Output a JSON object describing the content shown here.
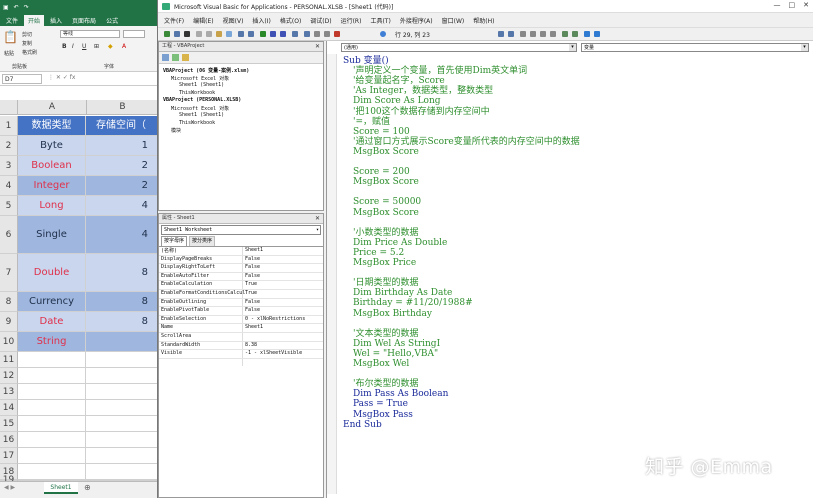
{
  "excel": {
    "ribbon_tabs": [
      "文件",
      "开始",
      "插入",
      "页面布局",
      "公式"
    ],
    "ribbon": {
      "paste": "粘贴",
      "cut": "剪切",
      "copy": "复制",
      "format_painter": "格式刷",
      "clipboard": "剪贴板",
      "font_name": "等线",
      "font_group": "字体"
    },
    "name_box": "D7",
    "columns": [
      "A",
      "B"
    ],
    "header": {
      "col_a": "数据类型",
      "col_b": "存储空间（"
    },
    "rows": [
      {
        "row": "1",
        "a": "数据类型",
        "b": "存储空间（"
      },
      {
        "row": "2",
        "a": "Byte",
        "b": "1"
      },
      {
        "row": "3",
        "a": "Boolean",
        "b": "2"
      },
      {
        "row": "4",
        "a": "Integer",
        "b": "2"
      },
      {
        "row": "5",
        "a": "Long",
        "b": "4"
      },
      {
        "row": "6",
        "a": "Single",
        "b": "4"
      },
      {
        "row": "7",
        "a": "Double",
        "b": "8"
      },
      {
        "row": "8",
        "a": "Currency",
        "b": "8"
      },
      {
        "row": "9",
        "a": "Date",
        "b": "8"
      },
      {
        "row": "10",
        "a": "String",
        "b": ""
      },
      {
        "row": "11",
        "a": "",
        "b": ""
      },
      {
        "row": "12",
        "a": "",
        "b": ""
      },
      {
        "row": "13",
        "a": "",
        "b": ""
      },
      {
        "row": "14",
        "a": "",
        "b": ""
      },
      {
        "row": "15",
        "a": "",
        "b": ""
      },
      {
        "row": "16",
        "a": "",
        "b": ""
      },
      {
        "row": "17",
        "a": "",
        "b": ""
      },
      {
        "row": "18",
        "a": "",
        "b": ""
      },
      {
        "row": "19",
        "a": "",
        "b": ""
      }
    ],
    "sheet_tab": "Sheet1",
    "colors": {
      "header": "#4472c4",
      "band_dark": "#9fb7df",
      "band_light": "#c9d6ee",
      "red_text": "#e0304a"
    }
  },
  "vba": {
    "title": "Microsoft Visual Basic for Applications - PERSONAL.XLSB - [Sheet1 (代码)]",
    "menu": [
      "文件(F)",
      "编辑(E)",
      "视图(V)",
      "插入(I)",
      "格式(O)",
      "调试(D)",
      "运行(R)",
      "工具(T)",
      "外接程序(A)",
      "窗口(W)",
      "帮助(H)"
    ],
    "cursor_pos": "行 29, 列 23",
    "project_pane": {
      "title": "工程 - VBAProject",
      "items": [
        "VBAProject (06  变量-案例.xlsm)",
        "Microsoft Excel 对象",
        "Sheet1 (Sheet1)",
        "ThisWorkbook",
        "VBAProject (PERSONAL.XLSB)",
        "Microsoft Excel 对象",
        "Sheet1 (Sheet1)",
        "ThisWorkbook",
        "模块"
      ]
    },
    "properties_pane": {
      "title": "属性 - Sheet1",
      "object": "Sheet1 Worksheet",
      "tabs": [
        "按字母序",
        "按分类序"
      ],
      "rows": [
        {
          "k": "(名称)",
          "v": "Sheet1"
        },
        {
          "k": "DisplayPageBreaks",
          "v": "False"
        },
        {
          "k": "DisplayRightToLeft",
          "v": "False"
        },
        {
          "k": "EnableAutoFilter",
          "v": "False"
        },
        {
          "k": "EnableCalculation",
          "v": "True"
        },
        {
          "k": "EnableFormatConditionsCalcul",
          "v": "True"
        },
        {
          "k": "EnableOutlining",
          "v": "False"
        },
        {
          "k": "EnablePivotTable",
          "v": "False"
        },
        {
          "k": "EnableSelection",
          "v": "0 - xlNoRestrictions"
        },
        {
          "k": "Name",
          "v": "Sheet1"
        },
        {
          "k": "ScrollArea",
          "v": ""
        },
        {
          "k": "StandardWidth",
          "v": "8.38"
        },
        {
          "k": "Visible",
          "v": "-1 - xlSheetVisible"
        }
      ]
    },
    "code": {
      "object_combo": "(通用)",
      "proc_combo": "变量",
      "lines": [
        {
          "t": "Sub 变量()",
          "c": "kw",
          "x": 0
        },
        {
          "t": "'声明定义一个变量，首先使用Dim英文单词",
          "c": "cm",
          "x": 2
        },
        {
          "t": "'给变量起名字，Score",
          "c": "cm",
          "x": 2
        },
        {
          "t": "'As Integer，数据类型，整数类型",
          "c": "cm",
          "x": 2
        },
        {
          "t": "Dim Score As Long",
          "c": "cm",
          "x": 2
        },
        {
          "t": "'把100这个数据存储到内存空间中",
          "c": "cm",
          "x": 2
        },
        {
          "t": "'=，赋值",
          "c": "cm",
          "x": 2
        },
        {
          "t": "Score = 100",
          "c": "cm",
          "x": 2
        },
        {
          "t": "'通过窗口方式展示Score变量所代表的内存空间中的数据",
          "c": "cm",
          "x": 2
        },
        {
          "t": "MsgBox Score",
          "c": "cm",
          "x": 2
        },
        {
          "t": "",
          "c": "cm",
          "x": 2
        },
        {
          "t": "Score = 200",
          "c": "cm",
          "x": 2
        },
        {
          "t": "MsgBox Score",
          "c": "cm",
          "x": 2
        },
        {
          "t": "",
          "c": "cm",
          "x": 2
        },
        {
          "t": "Score = 50000",
          "c": "cm",
          "x": 2
        },
        {
          "t": "MsgBox Score",
          "c": "cm",
          "x": 2
        },
        {
          "t": "",
          "c": "cm",
          "x": 2
        },
        {
          "t": "'小数类型的数据",
          "c": "cm",
          "x": 2
        },
        {
          "t": "Dim Price As Double",
          "c": "cm",
          "x": 2
        },
        {
          "t": "Price = 5.2",
          "c": "cm",
          "x": 2
        },
        {
          "t": "MsgBox Price",
          "c": "cm",
          "x": 2
        },
        {
          "t": "",
          "c": "cm",
          "x": 2
        },
        {
          "t": "'日期类型的数据",
          "c": "cm",
          "x": 2
        },
        {
          "t": "Dim Birthday As Date",
          "c": "cm",
          "x": 2
        },
        {
          "t": "Birthday = #11/20/1988#",
          "c": "cm",
          "x": 2
        },
        {
          "t": "MsgBox Birthday",
          "c": "cm",
          "x": 2
        },
        {
          "t": "",
          "c": "cm",
          "x": 2
        },
        {
          "t": "'文本类型的数据",
          "c": "cm",
          "x": 2
        },
        {
          "t": "Dim Wel As StringI",
          "c": "cm",
          "x": 2
        },
        {
          "t": "Wel = \"Hello,VBA\"",
          "c": "cm",
          "x": 2
        },
        {
          "t": "MsgBox Wel",
          "c": "cm",
          "x": 2
        },
        {
          "t": "",
          "c": "cm",
          "x": 2
        },
        {
          "t": "'布尔类型的数据",
          "c": "cm",
          "x": 2
        },
        {
          "t": "Dim Pass As Boolean",
          "c": "kw",
          "x": 2
        },
        {
          "t": "Pass = True",
          "c": "kw",
          "x": 2
        },
        {
          "t": "MsgBox Pass",
          "c": "kw",
          "x": 2
        },
        {
          "t": "End Sub",
          "c": "kw",
          "x": 0
        }
      ]
    }
  },
  "watermark": "知乎 @Emma"
}
